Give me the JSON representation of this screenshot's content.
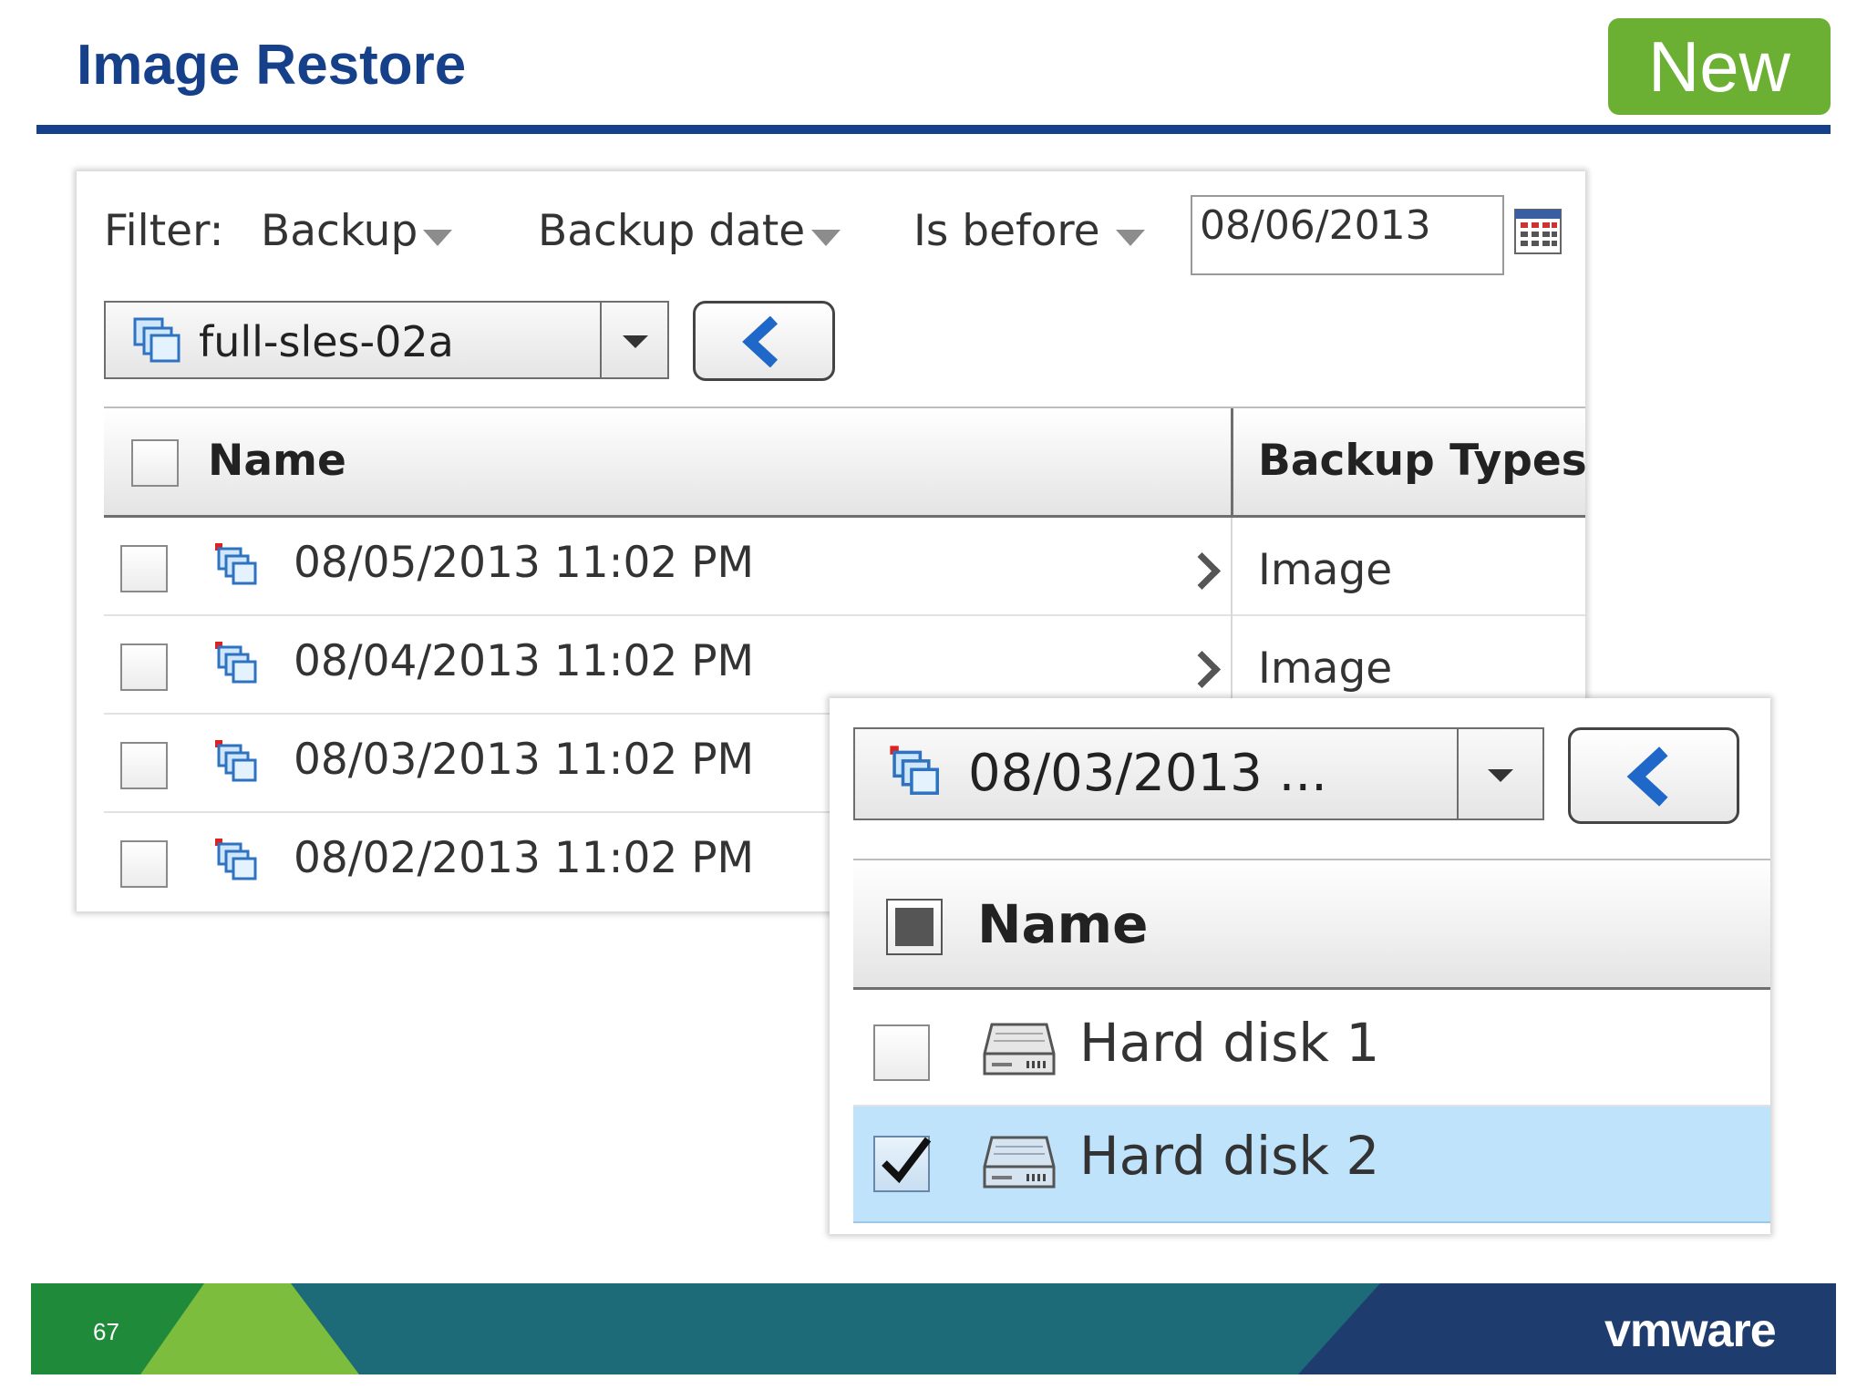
{
  "slide": {
    "title": "Image Restore",
    "badge": "New",
    "page_number": "67",
    "logo": "vmware"
  },
  "colors": {
    "title_blue": "#17408b",
    "badge_green": "#6cb033",
    "selection_blue": "#bfe3fb",
    "footer_green": "#1e8a3a",
    "footer_teal": "#1d6a78",
    "footer_navy": "#1f3c6e"
  },
  "filter": {
    "label": "Filter:",
    "field1": "Backup",
    "field2": "Backup date",
    "operator": "Is before",
    "date_value": "08/06/2013",
    "calendar_icon": "calendar-icon"
  },
  "vm_selector": {
    "value": "full-sles-02a",
    "icon": "vm-icon",
    "back_icon": "back-chevron-icon"
  },
  "backup_grid": {
    "columns": [
      "Name",
      "Backup Types"
    ],
    "rows": [
      {
        "name": "08/05/2013 11:02 PM",
        "type": "Image"
      },
      {
        "name": "08/04/2013 11:02 PM",
        "type": "Image"
      },
      {
        "name": "08/03/2013 11:02 PM",
        "type": ""
      },
      {
        "name": "08/02/2013 11:02 PM",
        "type": ""
      }
    ]
  },
  "restore_panel": {
    "selector_value": "08/03/2013 ...",
    "columns": [
      "Name"
    ],
    "rows": [
      {
        "name": "Hard disk 1",
        "checked": false
      },
      {
        "name": "Hard disk 2",
        "checked": true
      }
    ]
  }
}
